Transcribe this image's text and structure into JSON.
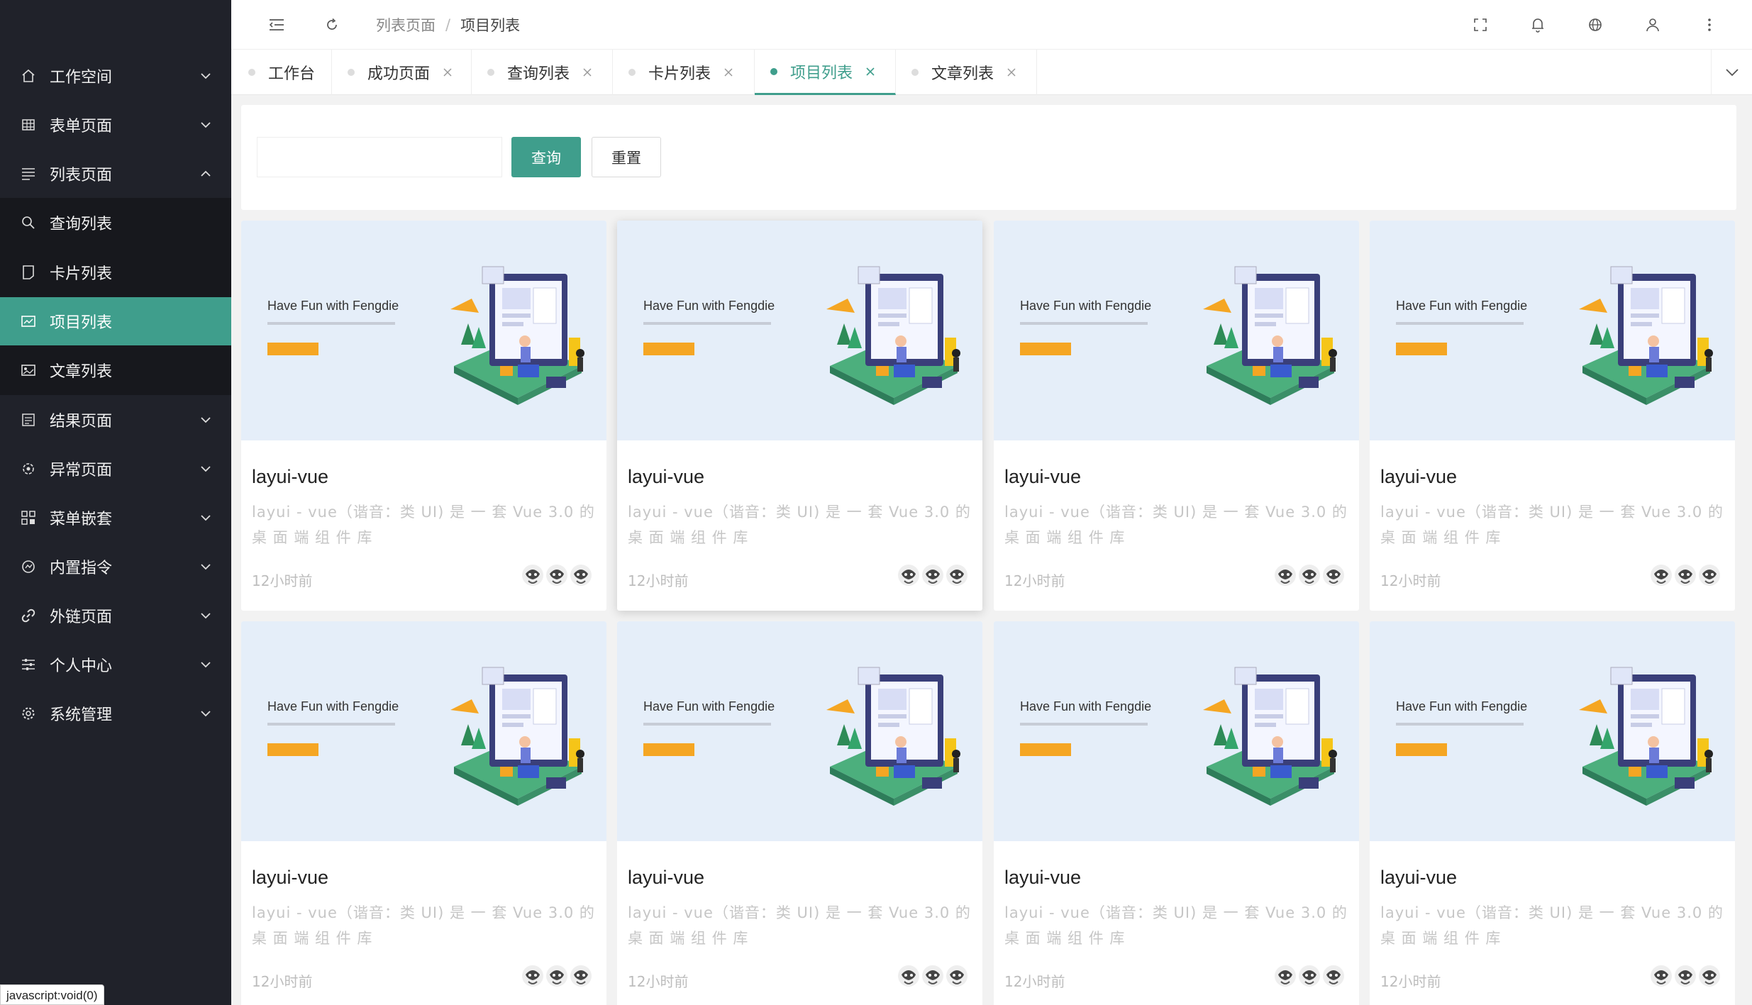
{
  "sidebar": {
    "items": [
      {
        "label": "工作空间",
        "icon": "home-icon"
      },
      {
        "label": "表单页面",
        "icon": "table-icon"
      },
      {
        "label": "列表页面",
        "icon": "list-icon"
      },
      {
        "label": "查询列表",
        "icon": "search-icon"
      },
      {
        "label": "卡片列表",
        "icon": "card-icon"
      },
      {
        "label": "项目列表",
        "icon": "project-icon"
      },
      {
        "label": "文章列表",
        "icon": "article-icon"
      },
      {
        "label": "结果页面",
        "icon": "result-icon"
      },
      {
        "label": "异常页面",
        "icon": "error-icon"
      },
      {
        "label": "菜单嵌套",
        "icon": "nested-menu-icon"
      },
      {
        "label": "内置指令",
        "icon": "directive-icon"
      },
      {
        "label": "外链页面",
        "icon": "link-icon"
      },
      {
        "label": "个人中心",
        "icon": "settings-sliders-icon"
      },
      {
        "label": "系统管理",
        "icon": "gear-icon"
      }
    ]
  },
  "header": {
    "breadcrumb_parent": "列表页面",
    "breadcrumb_separator": "/",
    "breadcrumb_current": "项目列表"
  },
  "tabs": [
    {
      "label": "工作台"
    },
    {
      "label": "成功页面"
    },
    {
      "label": "查询列表"
    },
    {
      "label": "卡片列表"
    },
    {
      "label": "项目列表"
    },
    {
      "label": "文章列表"
    }
  ],
  "search": {
    "placeholder": "",
    "value": "",
    "query_label": "查询",
    "reset_label": "重置"
  },
  "cards": [
    {
      "cover_title": "Have Fun with Fengdie",
      "title": "layui-vue",
      "description": "layui - vue（谐音：类 UI) 是 一 套 Vue 3.0 的 桌 面 端 组 件 库",
      "time": "12小时前"
    },
    {
      "cover_title": "Have Fun with Fengdie",
      "title": "layui-vue",
      "description": "layui - vue（谐音：类 UI) 是 一 套 Vue 3.0 的 桌 面 端 组 件 库",
      "time": "12小时前"
    },
    {
      "cover_title": "Have Fun with Fengdie",
      "title": "layui-vue",
      "description": "layui - vue（谐音：类 UI) 是 一 套 Vue 3.0 的 桌 面 端 组 件 库",
      "time": "12小时前"
    },
    {
      "cover_title": "Have Fun with Fengdie",
      "title": "layui-vue",
      "description": "layui - vue（谐音：类 UI) 是 一 套 Vue 3.0 的 桌 面 端 组 件 库",
      "time": "12小时前"
    },
    {
      "cover_title": "Have Fun with Fengdie",
      "title": "layui-vue",
      "description": "layui - vue（谐音：类 UI) 是 一 套 Vue 3.0 的 桌 面 端 组 件 库",
      "time": "12小时前"
    },
    {
      "cover_title": "Have Fun with Fengdie",
      "title": "layui-vue",
      "description": "layui - vue（谐音：类 UI) 是 一 套 Vue 3.0 的 桌 面 端 组 件 库",
      "time": "12小时前"
    },
    {
      "cover_title": "Have Fun with Fengdie",
      "title": "layui-vue",
      "description": "layui - vue（谐音：类 UI) 是 一 套 Vue 3.0 的 桌 面 端 组 件 库",
      "time": "12小时前"
    },
    {
      "cover_title": "Have Fun with Fengdie",
      "title": "layui-vue",
      "description": "layui - vue（谐音：类 UI) 是 一 套 Vue 3.0 的 桌 面 端 组 件 库",
      "time": "12小时前"
    }
  ],
  "status_bar": "javascript:void(0)",
  "colors": {
    "accent": "#3f9e8c",
    "sidebar_bg": "#20222a",
    "submenu_bg": "#17181d",
    "cover_bg": "#e5eef9"
  }
}
